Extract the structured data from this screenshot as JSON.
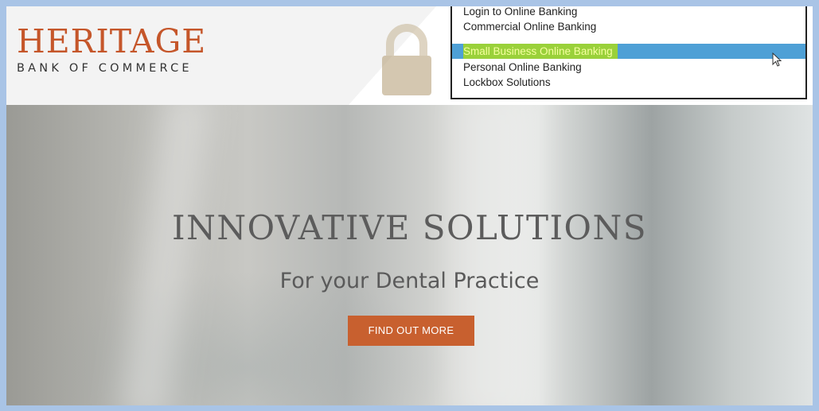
{
  "logo": {
    "name": "HERITAGE",
    "tagline": "BANK OF COMMERCE"
  },
  "login_menu": {
    "items": [
      {
        "label": "Login to Online Banking",
        "selected": false
      },
      {
        "label": "Commercial Online Banking",
        "selected": false
      },
      {
        "label": "Small Business Online Banking",
        "selected": true
      },
      {
        "label": "Personal Online Banking",
        "selected": false
      },
      {
        "label": "Lockbox Solutions",
        "selected": false
      }
    ]
  },
  "hero": {
    "title": "INNOVATIVE SOLUTIONS",
    "subtitle": "For your Dental Practice",
    "cta_label": "FIND OUT MORE"
  },
  "colors": {
    "brand": "#c5562a",
    "cta": "#c8602f",
    "selection": "#4ea0d6",
    "highlight": "#9ad13a"
  },
  "icons": [
    "lock-icon",
    "mouse-cursor-icon"
  ]
}
